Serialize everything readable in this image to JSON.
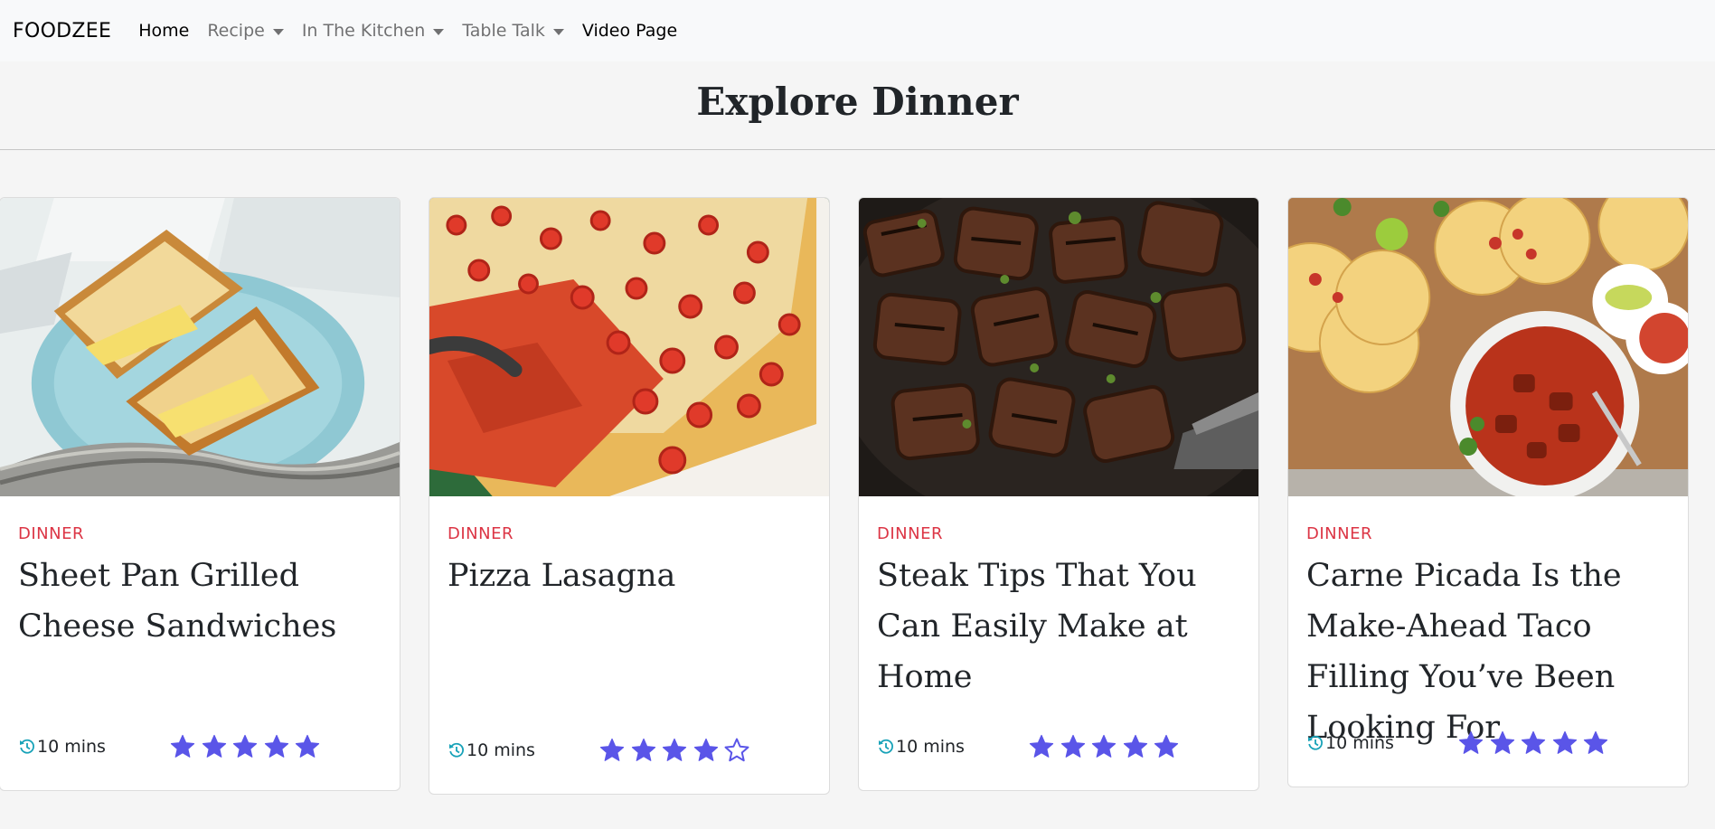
{
  "navbar": {
    "brand": "FOODZEE",
    "items": [
      {
        "label": "Home"
      },
      {
        "label": "Recipe"
      },
      {
        "label": "In The Kitchen"
      },
      {
        "label": "Table Talk"
      },
      {
        "label": "Video Page"
      }
    ]
  },
  "page": {
    "title": "Explore Dinner"
  },
  "cards": [
    {
      "category": "DINNER",
      "title": "Sheet Pan Grilled Cheese Sandwiches",
      "time": "10 mins",
      "rating": 5,
      "image": "grilled cheese sandwiches on blue plate"
    },
    {
      "category": "DINNER",
      "title": "Pizza Lasagna",
      "time": "10 mins",
      "rating": 4,
      "image": "pizza lasagna with pepperoni in white dish"
    },
    {
      "category": "DINNER",
      "title": "Steak Tips That You Can Easily Make at Home",
      "time": "10 mins",
      "rating": 5,
      "image": "seared steak tips in skillet"
    },
    {
      "category": "DINNER",
      "title": "Carne Picada Is the Make-Ahead Taco Filling You’ve Been Looking For",
      "time": "10 mins",
      "rating": 5,
      "image": "carne picada bowl with tortillas"
    }
  ],
  "colors": {
    "accent_star": "#5a55e8",
    "category": "#dc3545",
    "clock_icon": "#17a2b8"
  },
  "icons": {
    "time": "clock-history-icon",
    "rating": "star-icon"
  }
}
